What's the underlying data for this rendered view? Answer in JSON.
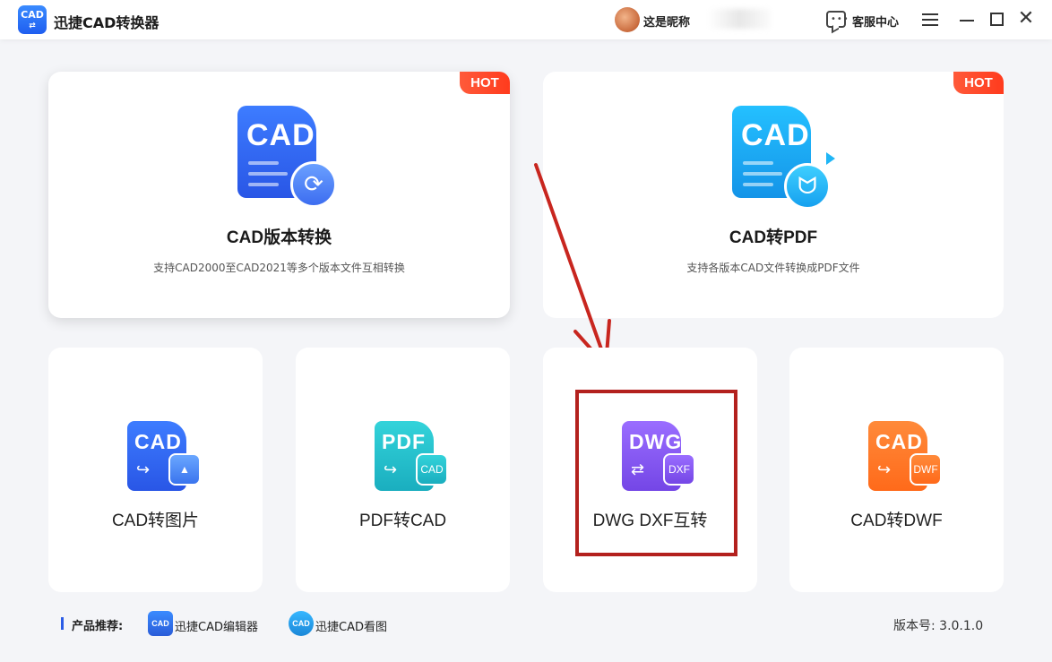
{
  "app": {
    "logo_text": "CAD",
    "title": "迅捷CAD转换器"
  },
  "header": {
    "nickname": "这是昵称",
    "service_label": "客服中心"
  },
  "cards_large": [
    {
      "title": "CAD版本转换",
      "desc": "支持CAD2000至CAD2021等多个版本文件互相转换",
      "badge": "HOT",
      "icon_text": "CAD",
      "icon": "refresh-icon"
    },
    {
      "title": "CAD转PDF",
      "desc": "支持各版本CAD文件转换成PDF文件",
      "badge": "HOT",
      "icon_text": "CAD",
      "icon": "pdf-icon"
    }
  ],
  "cards_small": [
    {
      "title": "CAD转图片",
      "icon_text": "CAD",
      "sub_icon": "image-icon"
    },
    {
      "title": "PDF转CAD",
      "icon_text": "PDF",
      "sub_text": "CAD"
    },
    {
      "title": "DWG DXF互转",
      "icon_text": "DWG",
      "sub_text": "DXF"
    },
    {
      "title": "CAD转DWF",
      "icon_text": "CAD",
      "sub_text": "DWF"
    }
  ],
  "footer": {
    "label": "产品推荐:",
    "products": [
      {
        "name": "迅捷CAD编辑器",
        "icon_text": "CAD"
      },
      {
        "name": "迅捷CAD看图",
        "icon_text": "CAD"
      }
    ],
    "version": "版本号: 3.0.1.0"
  },
  "colors": {
    "accent": "#2b5ce6",
    "hot": "#ff3b1d",
    "highlight": "#b3211e"
  }
}
